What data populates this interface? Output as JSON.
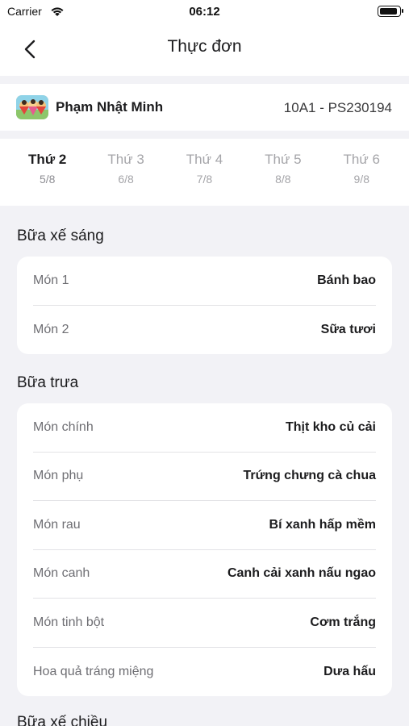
{
  "status_bar": {
    "carrier": "Carrier",
    "time": "06:12"
  },
  "nav": {
    "title": "Thực đơn"
  },
  "student": {
    "name": "Phạm Nhật Minh",
    "class_code": "10A1 - PS230194"
  },
  "days": [
    {
      "name": "Thứ 2",
      "date": "5/8",
      "active": true
    },
    {
      "name": "Thứ 3",
      "date": "6/8",
      "active": false
    },
    {
      "name": "Thứ 4",
      "date": "7/8",
      "active": false
    },
    {
      "name": "Thứ 5",
      "date": "8/8",
      "active": false
    },
    {
      "name": "Thứ 6",
      "date": "9/8",
      "active": false
    }
  ],
  "sections": [
    {
      "title": "Bữa xế sáng",
      "items": [
        {
          "label": "Món 1",
          "value": "Bánh bao"
        },
        {
          "label": "Món 2",
          "value": "Sữa tươi"
        }
      ]
    },
    {
      "title": "Bữa trưa",
      "items": [
        {
          "label": "Món chính",
          "value": "Thịt kho củ cải"
        },
        {
          "label": "Món phụ",
          "value": "Trứng chưng cà chua"
        },
        {
          "label": "Món rau",
          "value": "Bí xanh hấp mềm"
        },
        {
          "label": "Món canh",
          "value": "Canh cải xanh nấu ngao"
        },
        {
          "label": "Món tinh bột",
          "value": "Cơm trắng"
        },
        {
          "label": "Hoa quả tráng miệng",
          "value": "Dưa hấu"
        }
      ]
    },
    {
      "title": "Bữa xế chiều",
      "items": []
    }
  ]
}
